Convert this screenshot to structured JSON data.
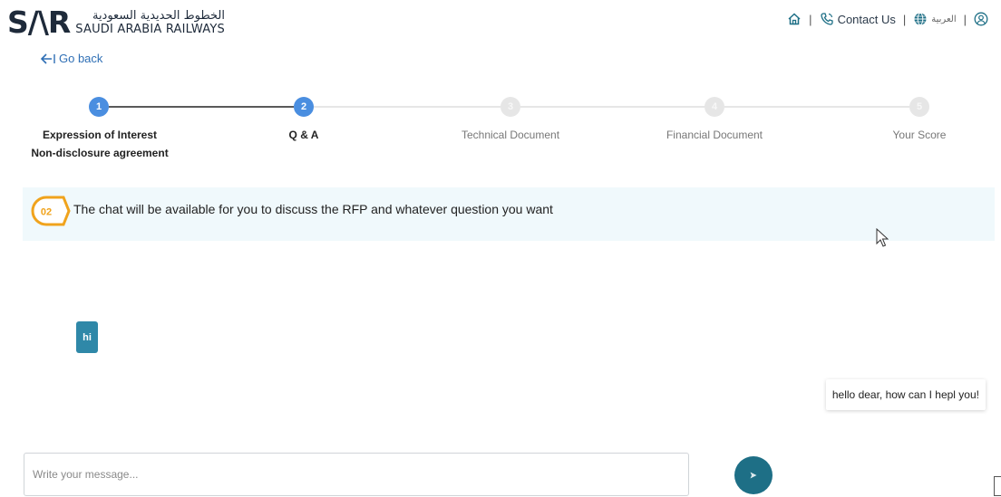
{
  "header": {
    "logo_mark": "S/\\R",
    "logo_arabic": "الخطوط الحديدية السعودية",
    "logo_english": "SAUDI ARABIA RAILWAYS",
    "nav": {
      "contact_label": "Contact Us",
      "language_label": "العربية",
      "separator": "|"
    }
  },
  "go_back": {
    "label": "Go back"
  },
  "stepper": {
    "steps": [
      {
        "number": "1",
        "label_line1": "Expression of Interest",
        "label_line2": "Non-disclosure agreement",
        "state": "active"
      },
      {
        "number": "2",
        "label_line1": "Q & A",
        "label_line2": "",
        "state": "active"
      },
      {
        "number": "3",
        "label_line1": "Technical Document",
        "label_line2": "",
        "state": "inactive"
      },
      {
        "number": "4",
        "label_line1": "Financial Document",
        "label_line2": "",
        "state": "inactive"
      },
      {
        "number": "5",
        "label_line1": "Your Score",
        "label_line2": "",
        "state": "inactive"
      }
    ]
  },
  "banner": {
    "number": "02",
    "text": "The chat will be available for you to discuss the RFP and whatever question you want"
  },
  "chat": {
    "messages": [
      {
        "side": "left",
        "text": "hi"
      },
      {
        "side": "right",
        "text": "hello dear, how can I hepl you!"
      }
    ]
  },
  "composer": {
    "value": "",
    "placeholder": "Write your message..."
  },
  "colors": {
    "accent_blue": "#4a8ee0",
    "step_inactive": "#e6e6e6",
    "banner_bg": "#f0f9fc",
    "badge_orange": "#f0a31c",
    "bubble_user": "#2f88a8",
    "send_button": "#1e6f86"
  },
  "icons": {
    "home": "home-icon",
    "phone": "phone-icon",
    "globe": "globe-icon",
    "user": "user-icon",
    "back": "arrow-left-icon",
    "send": "send-icon"
  }
}
